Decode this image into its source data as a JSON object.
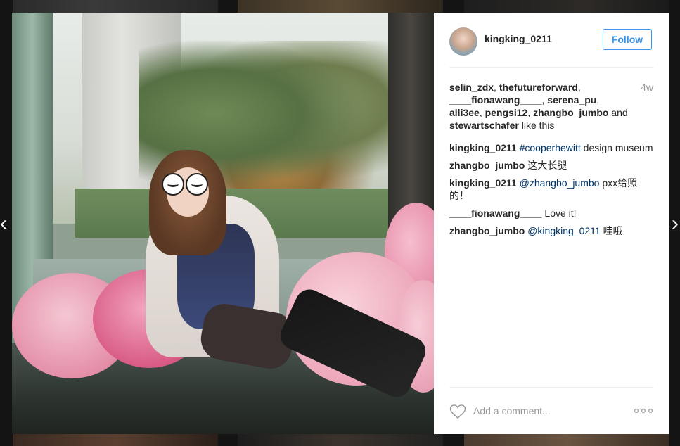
{
  "post": {
    "username": "kingking_0211",
    "follow_label": "Follow",
    "time_ago": "4w"
  },
  "likes": {
    "names": [
      "selin_zdx",
      "thefutureforward",
      "____fionawang____",
      "serena_pu",
      "alli3ee",
      "pengsi12",
      "zhangbo_jumbo",
      "stewartschafer"
    ],
    "sep1": ", ",
    "and_text": " and ",
    "suffix": " like this"
  },
  "comments": [
    {
      "user": "kingking_0211",
      "link": "#cooperhewitt",
      "text": " design museum"
    },
    {
      "user": "zhangbo_jumbo",
      "text": " 这大长腿"
    },
    {
      "user": "kingking_0211",
      "link": "@zhangbo_jumbo",
      "text": " pxx给照的！"
    },
    {
      "user": "____fionawang____",
      "text": " Love it!"
    },
    {
      "user": "zhangbo_jumbo",
      "link": "@kingking_0211",
      "text": " 哇哦"
    }
  ],
  "footer": {
    "comment_placeholder": "Add a comment..."
  },
  "icons": {
    "like": "heart-outline-icon",
    "more": "more-options-icon",
    "prev": "chevron-left-icon",
    "next": "chevron-right-icon"
  },
  "colors": {
    "accent": "#3897f0",
    "link": "#003569",
    "muted": "#999999",
    "text": "#262626",
    "overlay": "#141414"
  }
}
